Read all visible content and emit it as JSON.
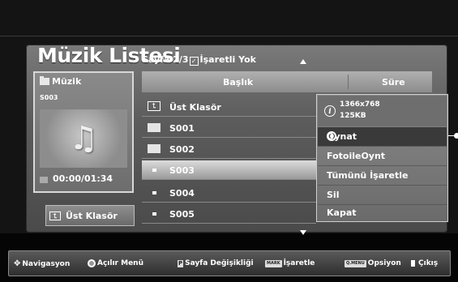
{
  "screen": {
    "title": "Müzik Listesi",
    "page": "Sayfa 2/3",
    "checked_status": "İşaretli Yok"
  },
  "preview": {
    "folder": "Müzik",
    "file": "S003",
    "time": "00:00/01:34",
    "art_icon": "music-note-icon"
  },
  "up_button": {
    "label": "Üst Klasör"
  },
  "list": {
    "col_title": "Başlık",
    "col_duration": "Süre",
    "rows": [
      {
        "label": "Üst Klasör",
        "icon": "up-folder-icon"
      },
      {
        "label": "S001",
        "icon": "folder-icon"
      },
      {
        "label": "S002",
        "icon": "folder-icon"
      },
      {
        "label": "S003",
        "icon": "file-icon",
        "selected": true
      },
      {
        "label": "S004",
        "icon": "file-icon"
      },
      {
        "label": "S005",
        "icon": "file-icon"
      }
    ]
  },
  "popup": {
    "resolution": "1366x768",
    "size": "125KB",
    "items": [
      "Oynat",
      "FotoileOynt",
      "Tümünü İşaretle",
      "Sil",
      "Kapat"
    ],
    "active_index": 0
  },
  "footer": {
    "navigation": "Navigasyon",
    "popup_menu": "Açılır Menü",
    "page_key": "P",
    "page_change": "Sayfa Değişikliği",
    "mark_key": "MARK",
    "mark": "İşaretle",
    "menu_key": "Q.MENU",
    "options": "Opsiyon",
    "exit": "Çıkış"
  }
}
